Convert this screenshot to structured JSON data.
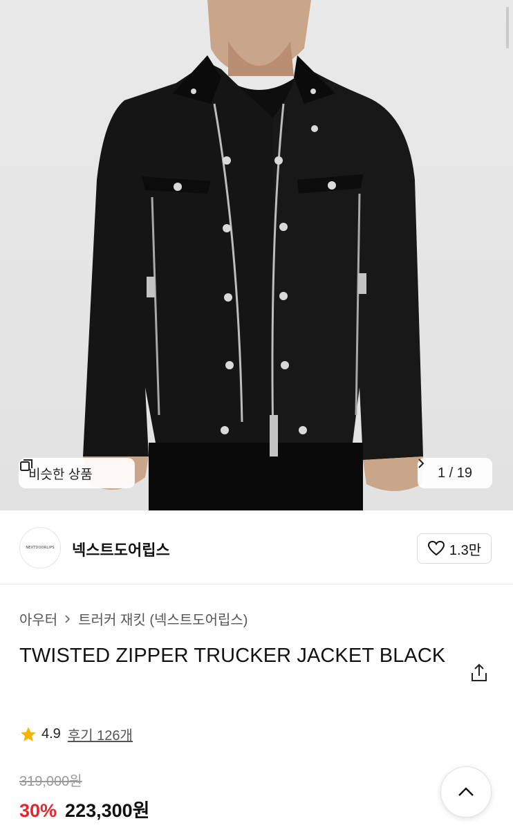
{
  "gallery": {
    "similar_label": "비슷한 상품",
    "pager_text": "1 / 19",
    "current_index": 1,
    "total": 19
  },
  "brand": {
    "logo_text": "NEXTDOORLIPS",
    "name": "넥스트도어립스",
    "like_count": "1.3만"
  },
  "breadcrumb": {
    "category": "아우터",
    "subcategory": "트러커 재킷 (넥스트도어립스)"
  },
  "product": {
    "title": "TWISTED ZIPPER TRUCKER JACKET BLACK",
    "rating": "4.9",
    "reviews_label": "후기 126개",
    "original_price": "319,000원",
    "discount": "30%",
    "price": "223,300원"
  },
  "colors": {
    "discount_red": "#e5262f",
    "star_yellow": "#f5b400",
    "jacket_black": "#141414"
  },
  "icons": [
    "similar-items-icon",
    "chevron-right-icon",
    "heart-icon",
    "share-icon",
    "star-icon",
    "chevron-up-icon"
  ]
}
